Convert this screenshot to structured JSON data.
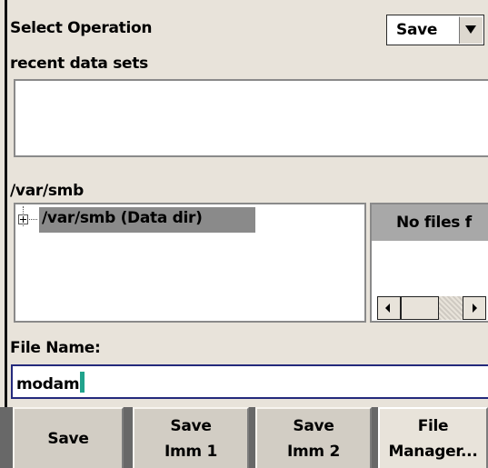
{
  "operation": {
    "label": "Select Operation",
    "selected": "Save"
  },
  "recent": {
    "label": "recent data sets"
  },
  "path": {
    "current": "/var/smb"
  },
  "tree": {
    "node": "/var/smb (Data dir)"
  },
  "files": {
    "header": "No files f"
  },
  "filename": {
    "label": "File Name:",
    "value": "modam"
  },
  "buttons": [
    {
      "lines": [
        "Save"
      ]
    },
    {
      "lines": [
        "Save",
        "Imm 1"
      ]
    },
    {
      "lines": [
        "Save",
        "Imm 2"
      ]
    },
    {
      "lines": [
        "File",
        "Manager..."
      ]
    }
  ],
  "icons": {
    "combo_arrow": "triangle-down",
    "tree_expander": "plus-box",
    "scroll_left": "triangle-left",
    "scroll_right": "triangle-right"
  }
}
